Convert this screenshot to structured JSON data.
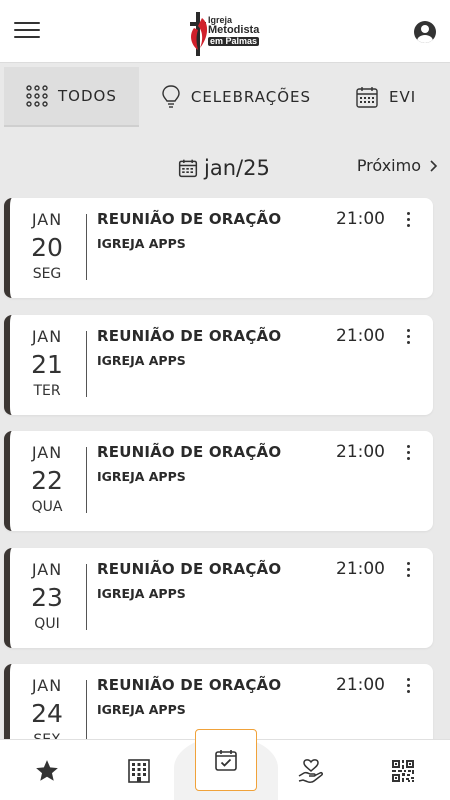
{
  "app": {
    "logo_lines": [
      "Igreja",
      "Metodista",
      "em Palmas"
    ]
  },
  "tabs": [
    {
      "label": "TODOS",
      "icon": "grid-icon",
      "active": true
    },
    {
      "label": "CELEBRAÇÕES",
      "icon": "lightbulb-icon",
      "active": false
    },
    {
      "label": "EVI",
      "icon": "calendar-icon",
      "active": false
    }
  ],
  "month": {
    "label": "jan/25",
    "next_label": "Próximo",
    "next_icon": "chevron-right-icon"
  },
  "events": [
    {
      "month": "JAN",
      "day": "20",
      "weekday": "SEG",
      "title": "REUNIÃO DE ORAÇÃO",
      "subtitle": "IGREJA APPS",
      "time": "21:00"
    },
    {
      "month": "JAN",
      "day": "21",
      "weekday": "TER",
      "title": "REUNIÃO DE ORAÇÃO",
      "subtitle": "IGREJA APPS",
      "time": "21:00"
    },
    {
      "month": "JAN",
      "day": "22",
      "weekday": "QUA",
      "title": "REUNIÃO DE ORAÇÃO",
      "subtitle": "IGREJA APPS",
      "time": "21:00"
    },
    {
      "month": "JAN",
      "day": "23",
      "weekday": "QUI",
      "title": "REUNIÃO DE ORAÇÃO",
      "subtitle": "IGREJA APPS",
      "time": "21:00"
    },
    {
      "month": "JAN",
      "day": "24",
      "weekday": "SEX",
      "title": "REUNIÃO DE ORAÇÃO",
      "subtitle": "IGREJA APPS",
      "time": "21:00"
    }
  ],
  "bottom_nav": [
    {
      "icon": "star-icon",
      "active": false
    },
    {
      "icon": "building-icon",
      "active": false
    },
    {
      "icon": "calendar-check-icon",
      "active": true
    },
    {
      "icon": "heart-hand-icon",
      "active": false
    },
    {
      "icon": "qr-code-icon",
      "active": false
    }
  ],
  "colors": {
    "accent_border": "#f0a23a",
    "card_stripe": "#3b3633",
    "background": "#e9e9e9"
  }
}
